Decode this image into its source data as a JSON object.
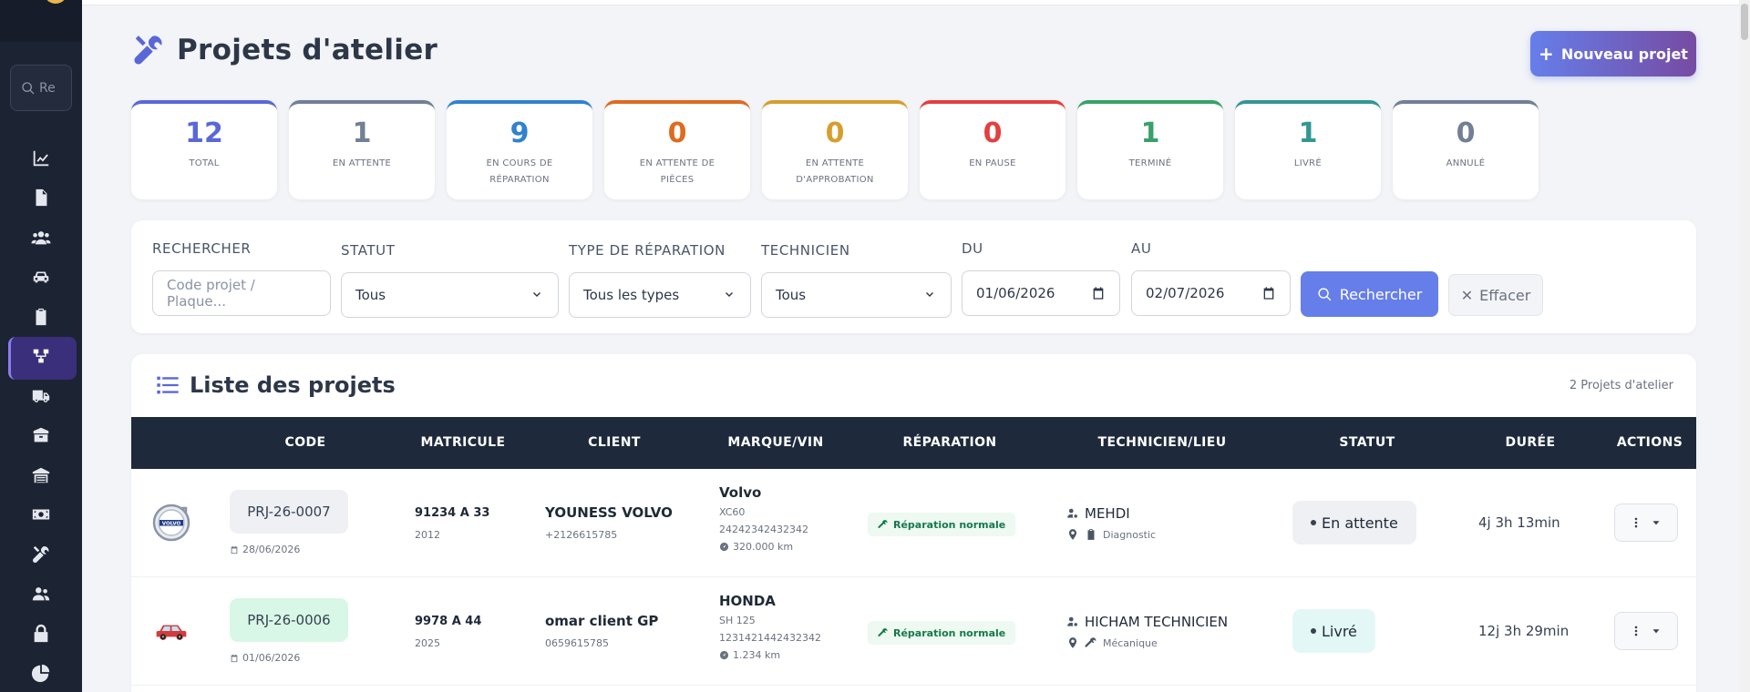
{
  "sidebar": {
    "search_placeholder": "Re",
    "items": [
      {
        "icon": "chart-line-icon"
      },
      {
        "icon": "file-icon"
      },
      {
        "icon": "users-icon"
      },
      {
        "icon": "car-icon"
      },
      {
        "icon": "clipboard-icon"
      },
      {
        "icon": "workflow-icon",
        "active": true
      },
      {
        "icon": "truck-icon"
      },
      {
        "icon": "box-icon"
      },
      {
        "icon": "warehouse-icon"
      },
      {
        "icon": "money-icon"
      },
      {
        "icon": "tools-icon"
      },
      {
        "icon": "user-group-icon"
      },
      {
        "icon": "lock-icon"
      },
      {
        "icon": "pie-chart-icon"
      }
    ]
  },
  "header": {
    "title": "Projets d'atelier",
    "new_button": "Nouveau projet"
  },
  "stats": [
    {
      "value": "12",
      "label": "TOTAL",
      "color": "#5a67d8"
    },
    {
      "value": "1",
      "label": "EN ATTENTE",
      "color": "#718096"
    },
    {
      "value": "9",
      "label": "EN COURS DE RÉPARATION",
      "color": "#3182ce"
    },
    {
      "value": "0",
      "label": "EN ATTENTE DE PIÈCES",
      "color": "#dd6b20"
    },
    {
      "value": "0",
      "label": "EN ATTENTE D'APPROBATION",
      "color": "#d69e2e"
    },
    {
      "value": "0",
      "label": "EN PAUSE",
      "color": "#e53e3e"
    },
    {
      "value": "1",
      "label": "TERMINÉ",
      "color": "#38a169"
    },
    {
      "value": "1",
      "label": "LIVRÉ",
      "color": "#319795"
    },
    {
      "value": "0",
      "label": "ANNULÉ",
      "color": "#718096"
    }
  ],
  "filters": {
    "search_label": "RECHERCHER",
    "search_placeholder": "Code projet / Plaque...",
    "statut_label": "STATUT",
    "statut_value": "Tous",
    "type_label": "TYPE DE RÉPARATION",
    "type_value": "Tous les types",
    "tech_label": "TECHNICIEN",
    "tech_value": "Tous",
    "du_label": "DU",
    "du_value": "01/06/2026",
    "au_label": "AU",
    "au_value": "02/07/2026",
    "search_button": "Rechercher",
    "clear_button": "Effacer"
  },
  "list": {
    "title": "Liste des projets",
    "count": "2 Projets d'atelier",
    "columns": [
      "CODE",
      "MATRICULE",
      "CLIENT",
      "MARQUE/VIN",
      "RÉPARATION",
      "TECHNICIEN/LIEU",
      "STATUT",
      "DURÉE",
      "ACTIONS"
    ],
    "rows": [
      {
        "logo": "volvo-logo-icon",
        "code": "PRJ-26-0007",
        "code_bg": "#eef0f4",
        "date": "28/06/2026",
        "plate": "91234 A 33",
        "year": "2012",
        "client": "YOUNESS VOLVO",
        "phone": "+2126615785",
        "brand": "Volvo",
        "model": "XC60",
        "vin": "24242342432342",
        "km": "320.000 km",
        "repair": "Réparation normale",
        "technician": "MEHDI",
        "location": "Diagnostic",
        "status": "En attente",
        "status_bg": "#eef0f4",
        "duration": "4j 3h 13min"
      },
      {
        "logo": "car-red-icon",
        "code": "PRJ-26-0006",
        "code_bg": "#d8f7e6",
        "date": "01/06/2026",
        "plate": "9978 A 44",
        "year": "2025",
        "client": "omar client GP",
        "phone": "0659615785",
        "brand": "HONDA",
        "model": "SH 125",
        "vin": "1231421442432342",
        "km": "1.234 km",
        "repair": "Réparation normale",
        "technician": "HICHAM TECHNICIEN",
        "location": "Mécanique",
        "status": "Livré",
        "status_bg": "#e3f8f6",
        "duration": "12j 3h 29min"
      }
    ]
  }
}
